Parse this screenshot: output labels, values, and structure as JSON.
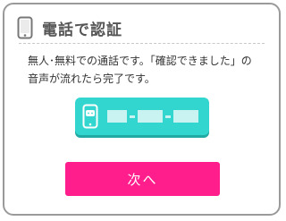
{
  "header": {
    "title": "電話で認証",
    "icon": "phone-icon"
  },
  "description": {
    "line1": "無人･無料での通話です。「確認できました」の",
    "line2": "音声が流れたら完了です。"
  },
  "tel_button": {
    "icon": "phone-chat-icon",
    "number_obscured": true
  },
  "next_button": {
    "label": "次へ"
  },
  "colors": {
    "accent_teal": "#33d6cf",
    "primary_pink": "#ff1e8c",
    "title_gray": "#555555"
  }
}
